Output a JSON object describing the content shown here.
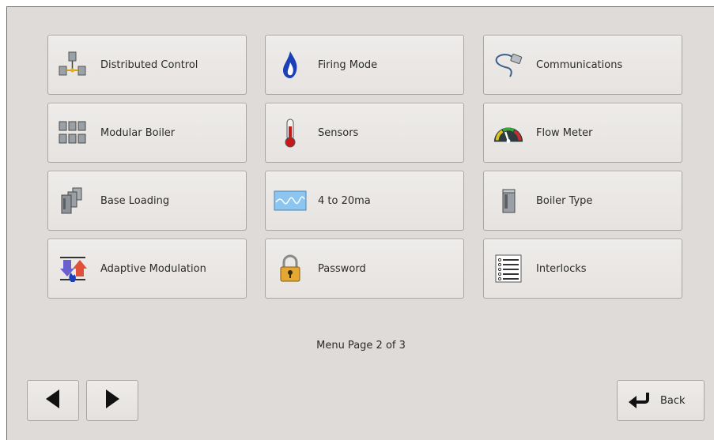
{
  "menu": {
    "tiles": [
      {
        "label": "Distributed Control",
        "icon": "network-nodes-icon"
      },
      {
        "label": "Firing Mode",
        "icon": "flame-icon"
      },
      {
        "label": "Communications",
        "icon": "network-cable-icon"
      },
      {
        "label": "Modular Boiler",
        "icon": "boiler-array-icon"
      },
      {
        "label": "Sensors",
        "icon": "thermometer-icon"
      },
      {
        "label": "Flow Meter",
        "icon": "gauge-icon"
      },
      {
        "label": "Base Loading",
        "icon": "boilers-stack-icon"
      },
      {
        "label": "4 to 20ma",
        "icon": "signal-wave-icon"
      },
      {
        "label": "Boiler Type",
        "icon": "boiler-unit-icon"
      },
      {
        "label": "Adaptive Modulation",
        "icon": "modulation-arrows-icon"
      },
      {
        "label": "Password",
        "icon": "padlock-icon"
      },
      {
        "label": "Interlocks",
        "icon": "list-icon"
      }
    ],
    "page_status": "Menu Page 2 of 3"
  },
  "nav": {
    "prev_icon": "left-arrow-icon",
    "next_icon": "right-arrow-icon",
    "back_label": "Back",
    "back_icon": "return-arrow-icon"
  },
  "colors": {
    "background": "#dfdbd8",
    "tile_border": "#a9a5a1",
    "text": "#2b2b2b"
  }
}
